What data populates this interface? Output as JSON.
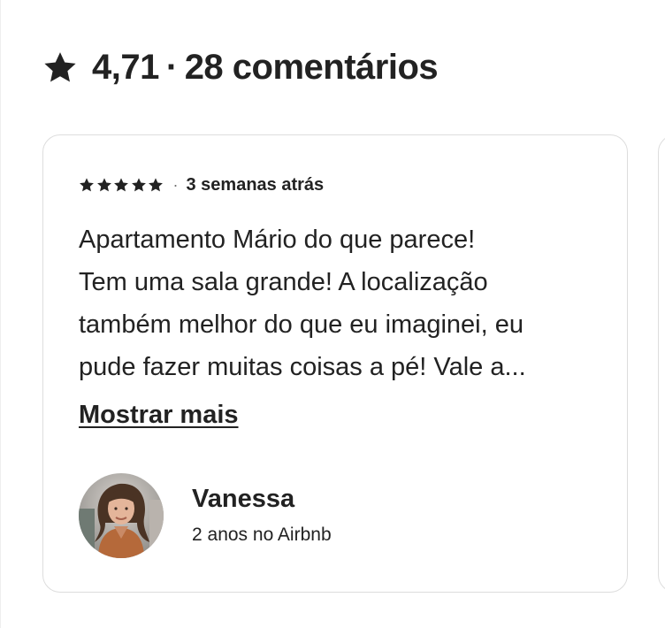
{
  "header": {
    "icon": "star-icon",
    "rating": "4,71",
    "separator": "·",
    "reviews_count_label": "28 comentários"
  },
  "review": {
    "stars": 5,
    "star_icon": "star-icon",
    "separator": "·",
    "time_ago": "3 semanas atrás",
    "text": "Apartamento Mário do que parece!\nTem uma sala grande! A localização\ntambém melhor do que eu imaginei, eu\npude fazer muitas coisas a pé! Vale a...",
    "show_more_label": "Mostrar mais",
    "reviewer": {
      "name": "Vanessa",
      "meta": "2 anos no Airbnb",
      "avatar": "avatar-photo"
    }
  },
  "colors": {
    "text": "#222222",
    "secondary": "#717171",
    "border": "#dddddd"
  }
}
